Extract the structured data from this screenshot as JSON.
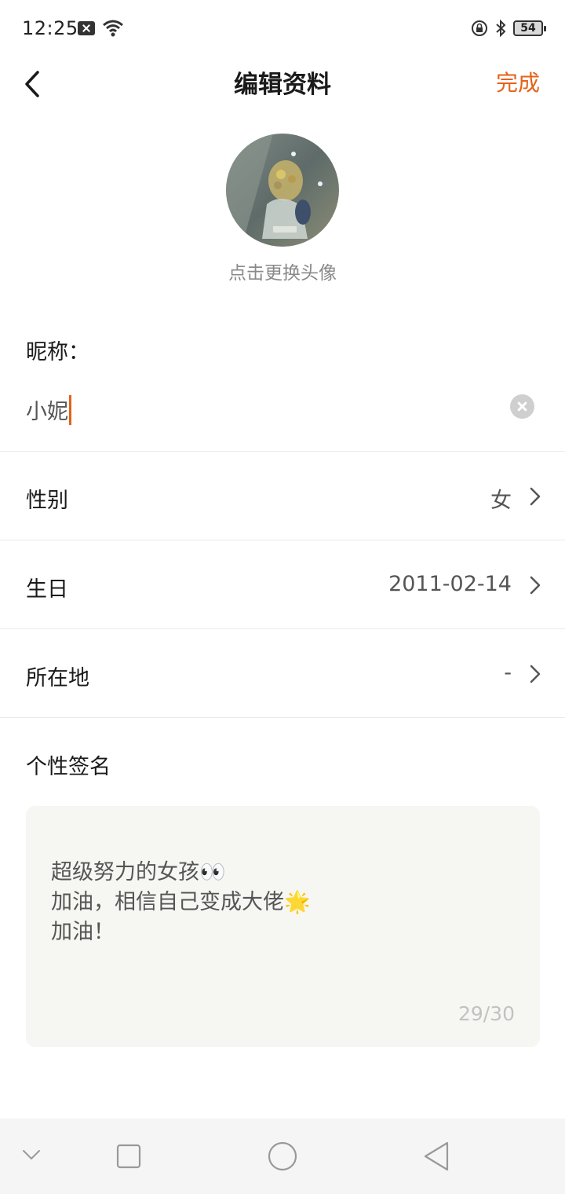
{
  "status_bar": {
    "time": "12:25",
    "battery": "54"
  },
  "header": {
    "title": "编辑资料",
    "done_label": "完成"
  },
  "avatar": {
    "hint": "点击更换头像"
  },
  "nickname": {
    "label": "昵称：",
    "value": "小妮"
  },
  "rows": [
    {
      "label": "性别",
      "value": "女"
    },
    {
      "label": "生日",
      "value": "2011-02-14"
    },
    {
      "label": "所在地",
      "value": "-"
    }
  ],
  "signature": {
    "label": "个性签名",
    "text": "超级努力的女孩👀\n加油，相信自己变成大佬🌟\n加油！",
    "count": "29/30"
  },
  "colors": {
    "accent": "#e4631a",
    "hint": "#8a8a8a",
    "signature_bg": "#f6f6f3"
  }
}
